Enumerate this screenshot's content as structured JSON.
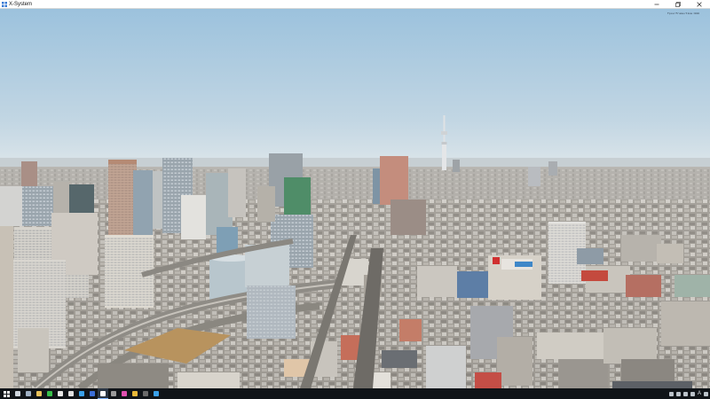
{
  "window": {
    "title": "X-System",
    "icon": "xplane-app-icon",
    "fps_readout": "fpss/frame/time:000"
  },
  "controls": {
    "minimize": "minimize-icon",
    "maximize": "maximize-icon",
    "close": "close-icon"
  },
  "scene": {
    "sky_top": "#9fc4de",
    "sky_horizon": "#d7e2e8",
    "city_near": "#8f8a84",
    "city_far": "#b9b9b8"
  },
  "taskbar": {
    "start": "windows-start-icon",
    "apps": [
      {
        "icon": "search-icon",
        "color": "#cfd6de"
      },
      {
        "icon": "task-view-icon",
        "color": "#9fb0c4"
      },
      {
        "icon": "file-explorer-icon",
        "color": "#e9c25a"
      },
      {
        "icon": "app-green-icon",
        "color": "#38c04a"
      },
      {
        "icon": "app-white-icon",
        "color": "#e8e8e8"
      },
      {
        "icon": "chrome-icon",
        "color": "#e0e0e0"
      },
      {
        "icon": "edge-icon",
        "color": "#3aa0e8"
      },
      {
        "icon": "app-blue-icon",
        "color": "#3b6fd8"
      },
      {
        "icon": "xplane-icon",
        "color": "#ffffff"
      },
      {
        "icon": "app-gray-icon",
        "color": "#9a9a9a"
      },
      {
        "icon": "app-pink-icon",
        "color": "#e050b0"
      },
      {
        "icon": "app-yellow-icon",
        "color": "#e8b838"
      },
      {
        "icon": "app-dark-icon",
        "color": "#6a6a6a"
      },
      {
        "icon": "edge-icon-2",
        "color": "#3aa0e8"
      }
    ],
    "tray_text": "A"
  }
}
